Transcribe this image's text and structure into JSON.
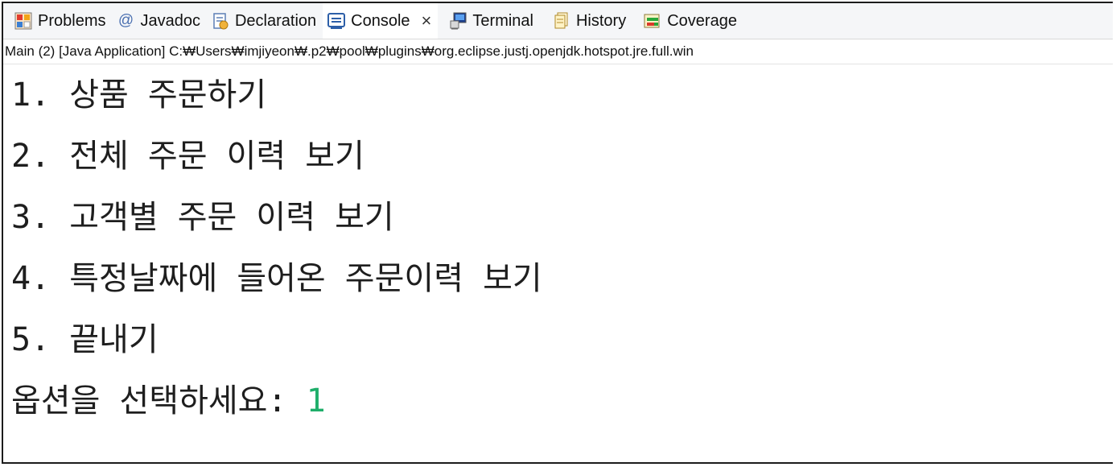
{
  "tabs": [
    {
      "label": "Problems",
      "icon": "problems-icon"
    },
    {
      "label": "Javadoc",
      "icon": "javadoc-icon"
    },
    {
      "label": "Declaration",
      "icon": "declaration-icon"
    },
    {
      "label": "Console",
      "icon": "console-icon",
      "active": true
    },
    {
      "label": "Terminal",
      "icon": "terminal-icon"
    },
    {
      "label": "History",
      "icon": "history-icon"
    },
    {
      "label": "Coverage",
      "icon": "coverage-icon"
    }
  ],
  "close_glyph": "×",
  "javadoc_glyph": "@",
  "launch_info": "Main (2) [Java Application] C:₩Users₩imjiyeon₩.p2₩pool₩plugins₩org.eclipse.justj.openjdk.hotspot.jre.full.win",
  "console": {
    "lines": [
      "1. 상품 주문하기",
      "2. 전체 주문 이력 보기",
      "3. 고객별 주문 이력 보기",
      "4. 특정날짜에 들어온 주문이력 보기",
      "5. 끝내기"
    ],
    "prompt": "옵션을 선택하세요: ",
    "input": "1"
  },
  "colors": {
    "input_text": "#1fae6a",
    "tabbar_bg": "#f5f6f8",
    "text": "#1e1e1e"
  }
}
